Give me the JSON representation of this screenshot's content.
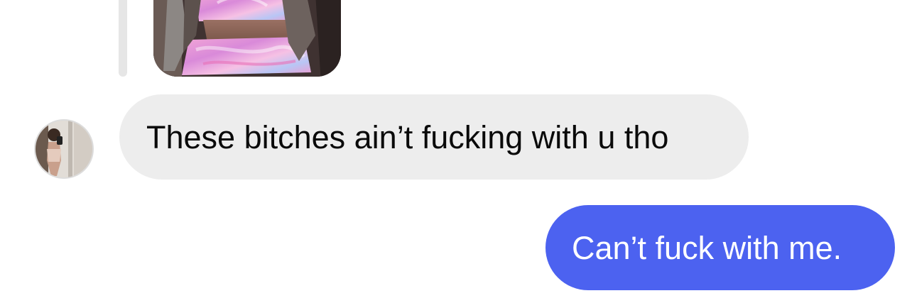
{
  "conversation": {
    "reply_preview": {
      "kind": "photo",
      "icon": "photo-thumbnail"
    },
    "messages": [
      {
        "direction": "incoming",
        "sender_avatar_icon": "avatar-photo",
        "text": "These bitches ain’t fucking with u tho"
      },
      {
        "direction": "outgoing",
        "text": "Can’t fuck with me."
      }
    ]
  },
  "colors": {
    "incoming_bubble": "#ededed",
    "outgoing_bubble": "#4c62f0",
    "incoming_text": "#0a0a0a",
    "outgoing_text": "#ffffff",
    "reply_bar": "#e6e6e6",
    "background": "#ffffff"
  }
}
